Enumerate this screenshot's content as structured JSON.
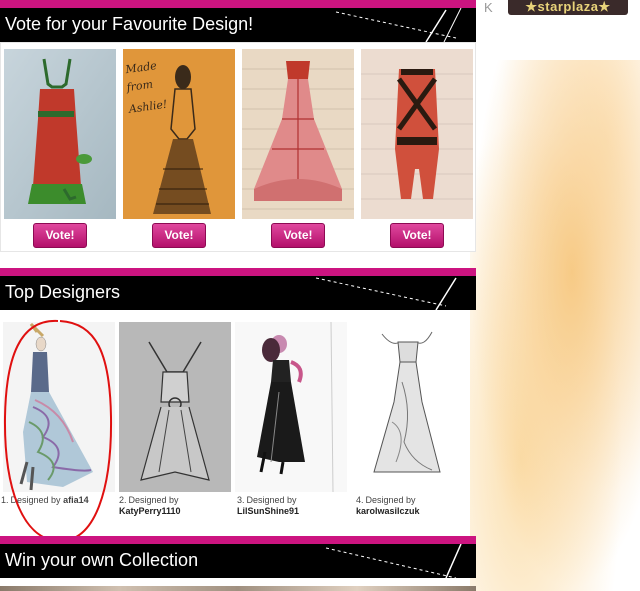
{
  "logo": {
    "text": "★starplaza★"
  },
  "vote": {
    "title": "Vote for your Favourite Design!",
    "button_label": "Vote!",
    "designs": [
      {
        "handwriting": ""
      },
      {
        "handwriting": "Made from Ashlie!"
      },
      {
        "handwriting": ""
      },
      {
        "handwriting": ""
      }
    ]
  },
  "top": {
    "title": "Top Designers",
    "designers": [
      {
        "rank": "1.",
        "prefix": "Designed by",
        "user": "afia14"
      },
      {
        "rank": "2.",
        "prefix": "Designed by",
        "user": "KatyPerry1110"
      },
      {
        "rank": "3.",
        "prefix": "Designed by",
        "user": "LilSunShine91"
      },
      {
        "rank": "4.",
        "prefix": "Designed by",
        "user": "karolwasilczuk"
      }
    ]
  },
  "win": {
    "title": "Win your own Collection"
  },
  "colors": {
    "brand_pink": "#cc1480",
    "header_black": "#000000",
    "annotation_red": "#e01010"
  }
}
